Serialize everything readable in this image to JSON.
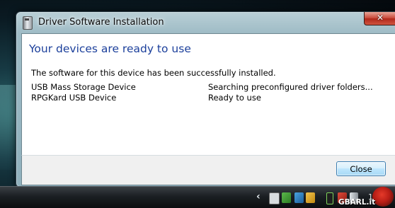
{
  "window": {
    "title": "Driver Software Installation",
    "close_glyph": "✕"
  },
  "dialog": {
    "heading": "Your devices are ready to use",
    "description": "The software for this device has been successfully installed.",
    "devices": [
      {
        "name": "USB Mass Storage Device",
        "status": "Searching preconfigured driver folders..."
      },
      {
        "name": "RPGKard USB Device",
        "status": "Ready to use"
      }
    ],
    "close_button_label": "Close"
  },
  "taskbar": {
    "tray_chevron": "‹",
    "clock": "13",
    "tray_icons": [
      "usb-device-icon",
      "network-check-icon",
      "network-icon",
      "shield-icon",
      "battery-icon",
      "safely-remove-icon",
      "volume-icon"
    ]
  },
  "watermark": "GBARL.it",
  "colors": {
    "heading": "#1b3f9b",
    "button_border": "#3c7fb1",
    "close_red": "#c9493a"
  }
}
